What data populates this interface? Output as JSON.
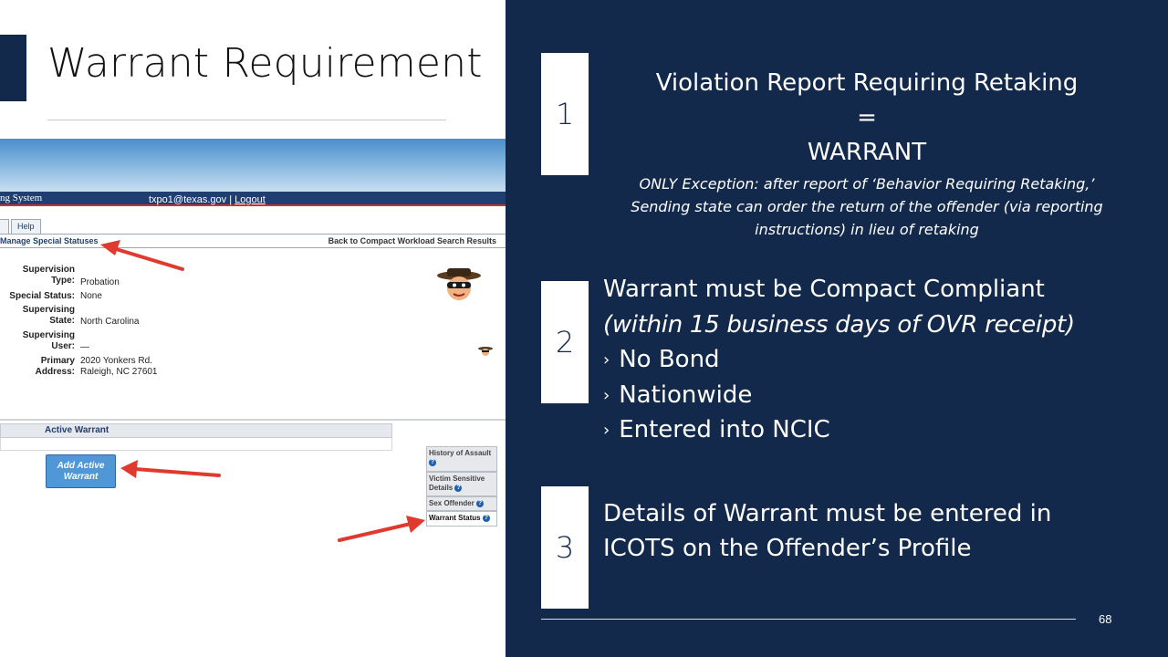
{
  "slide": {
    "title": "Warrant Requirement",
    "page_number": "68"
  },
  "screenshot": {
    "system_label": "ng System",
    "user_email": "txpo1@texas.gov",
    "separator": " | ",
    "logout_label": "Logout",
    "help_tab": "Help",
    "manage_link": "Manage Special Statuses",
    "back_link": "Back to Compact Workload Search Results",
    "fields": [
      {
        "label1": "Supervision",
        "label2": "Type:",
        "value": "Probation"
      },
      {
        "label1": "Special Status:",
        "label2": "",
        "value": "None"
      },
      {
        "label1": "Supervising",
        "label2": "State:",
        "value": "North Carolina"
      },
      {
        "label1": "Supervising",
        "label2": "User:",
        "value": "—"
      },
      {
        "label1": "Primary",
        "label2": "Address:",
        "value": "2020 Yonkers Rd.",
        "value2": "Raleigh, NC 27601"
      }
    ],
    "warrant_header": "Active Warrant",
    "add_button_line1": "Add Active",
    "add_button_line2": "Warrant",
    "side_items": {
      "assault": "History of Assault",
      "victim_line1": "Victim Sensitive",
      "victim_line2": "Details",
      "sex_offender": "Sex Offender",
      "warrant_status": "Warrant Status"
    },
    "icons": {
      "help": "question-mark-icon",
      "arrow": "red-arrow-icon",
      "avatar": "masked-bandit-avatar"
    },
    "colors": {
      "banner": "#4a8ecb",
      "nav": "#1f3e72",
      "button": "#4f97d6",
      "arrow": "#e03a2f"
    }
  },
  "points": {
    "one": {
      "number": "1",
      "line1": "Violation Report Requiring Retaking",
      "line2": "=",
      "line3": "WARRANT",
      "note_line1": "ONLY Exception: after report of ‘Behavior Requiring Retaking,’",
      "note_line2": "Sending state can order the return of the offender (via reporting",
      "note_line3": "instructions) in lieu of retaking"
    },
    "two": {
      "number": "2",
      "title": "Warrant must be Compact Compliant",
      "subtitle": "(within 15 business  days of OVR receipt)",
      "bullet_glyph": "›",
      "bullets": [
        "No Bond",
        "Nationwide",
        "Entered into NCIC"
      ]
    },
    "three": {
      "number": "3",
      "line1": "Details of Warrant must be entered in",
      "line2": "ICOTS on the Offender’s Profile"
    }
  },
  "theme": {
    "navy": "#13294b",
    "white": "#ffffff"
  }
}
